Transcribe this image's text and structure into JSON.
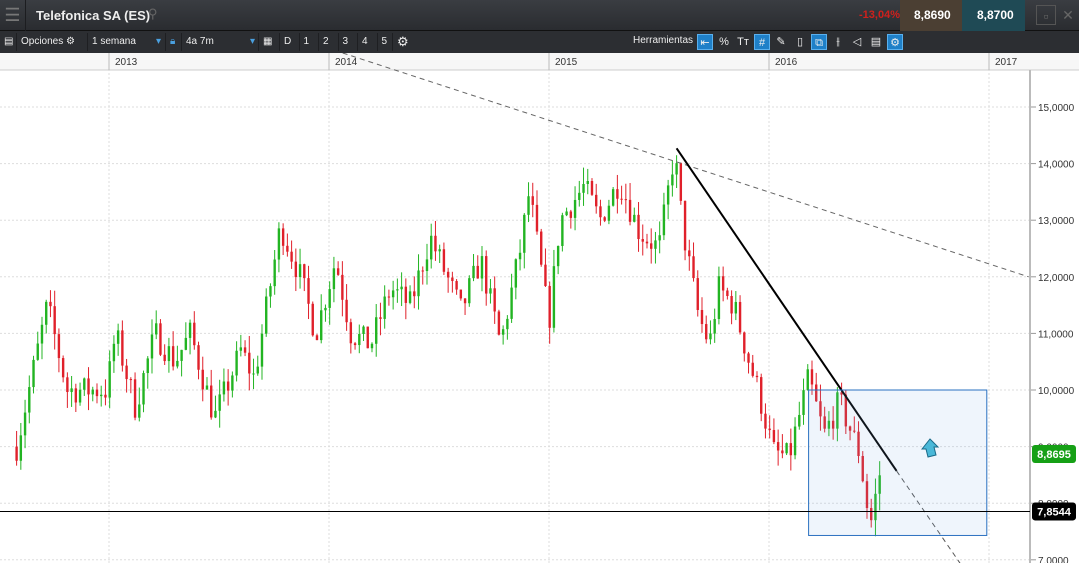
{
  "header": {
    "title": "Telefonica SA (ES)",
    "change": "-13,04%",
    "bid": "8,8690",
    "ask": "8,8700"
  },
  "toolbar": {
    "options": "Opciones",
    "period": "1 semana",
    "range": "4a 7m",
    "zoom_buttons": [
      "D",
      "1",
      "2",
      "3",
      "4",
      "5"
    ],
    "tools_label": "Herramientas",
    "tools": [
      {
        "icon": "back-icon",
        "glyph": "⇤",
        "on": true
      },
      {
        "icon": "percent-icon",
        "glyph": "%",
        "on": false
      },
      {
        "icon": "text-icon",
        "glyph": "Tт",
        "on": false
      },
      {
        "icon": "grid-icon",
        "glyph": "#",
        "on": true
      },
      {
        "icon": "draw-icon",
        "glyph": "✎",
        "on": false
      },
      {
        "icon": "candle-icon",
        "glyph": "▯",
        "on": false
      },
      {
        "icon": "compare-icon",
        "glyph": "⧉",
        "on": true
      },
      {
        "icon": "indicator-icon",
        "glyph": "⫲",
        "on": false
      },
      {
        "icon": "tag-icon",
        "glyph": "◁",
        "on": false
      },
      {
        "icon": "print-icon",
        "glyph": "▤",
        "on": false
      },
      {
        "icon": "settings-tool-icon",
        "glyph": "⚙",
        "on": true
      }
    ]
  },
  "chart_data": {
    "type": "candlestick",
    "x_ticks": [
      "2013",
      "2014",
      "2015",
      "2016",
      "2017"
    ],
    "y_ticks": [
      "15,0000",
      "14,0000",
      "13,0000",
      "12,0000",
      "11,0000",
      "10,0000",
      "9,0000",
      "8,0000",
      "7,0000"
    ],
    "ylim": [
      6.93,
      16.3
    ],
    "xlim": [
      2012.55,
      2017.2
    ],
    "weekly_close_anchors": [
      [
        2012.58,
        9.0
      ],
      [
        2012.72,
        11.5
      ],
      [
        2012.81,
        10.0
      ],
      [
        2012.99,
        10.0
      ],
      [
        2013.03,
        11.0
      ],
      [
        2013.12,
        9.7
      ],
      [
        2013.21,
        11.0
      ],
      [
        2013.3,
        10.5
      ],
      [
        2013.37,
        11.0
      ],
      [
        2013.48,
        9.5
      ],
      [
        2013.6,
        10.7
      ],
      [
        2013.66,
        10.2
      ],
      [
        2013.78,
        12.9
      ],
      [
        2013.87,
        12.0
      ],
      [
        2013.94,
        11.0
      ],
      [
        2014.03,
        12.3
      ],
      [
        2014.1,
        11.0
      ],
      [
        2014.19,
        10.8
      ],
      [
        2014.28,
        11.8
      ],
      [
        2014.37,
        11.5
      ],
      [
        2014.46,
        12.7
      ],
      [
        2014.6,
        11.4
      ],
      [
        2014.69,
        12.3
      ],
      [
        2014.78,
        10.8
      ],
      [
        2014.87,
        12.5
      ],
      [
        2014.91,
        13.5
      ],
      [
        2015.0,
        11.2
      ],
      [
        2015.05,
        13.0
      ],
      [
        2015.16,
        13.6
      ],
      [
        2015.23,
        13.0
      ],
      [
        2015.32,
        13.7
      ],
      [
        2015.41,
        12.8
      ],
      [
        2015.5,
        12.5
      ],
      [
        2015.57,
        14.2
      ],
      [
        2015.61,
        12.8
      ],
      [
        2015.68,
        11.3
      ],
      [
        2015.73,
        10.8
      ],
      [
        2015.77,
        11.8
      ],
      [
        2015.84,
        11.5
      ],
      [
        2015.91,
        10.5
      ],
      [
        2015.95,
        10.0
      ],
      [
        2016.02,
        8.9
      ],
      [
        2016.09,
        8.8
      ],
      [
        2016.18,
        10.2
      ],
      [
        2016.25,
        9.2
      ],
      [
        2016.32,
        9.8
      ],
      [
        2016.41,
        8.9
      ],
      [
        2016.46,
        7.6
      ],
      [
        2016.52,
        8.87
      ]
    ],
    "long_trendline": [
      [
        2013.79,
        16.3
      ],
      [
        2017.18,
        12.0
      ]
    ],
    "short_trendline": [
      [
        2015.58,
        14.27
      ],
      [
        2016.58,
        8.57
      ]
    ],
    "short_trendline_extension": [
      [
        2016.58,
        8.57
      ],
      [
        2016.87,
        6.93
      ]
    ],
    "box": {
      "x": [
        2016.18,
        2016.99
      ],
      "y": [
        7.43,
        10.0
      ]
    },
    "horizontal_line": 7.8544,
    "last_price_label": "8,8695",
    "line_price_label": "7,8544",
    "up_color": "#22b422",
    "down_color": "#e0202a"
  }
}
